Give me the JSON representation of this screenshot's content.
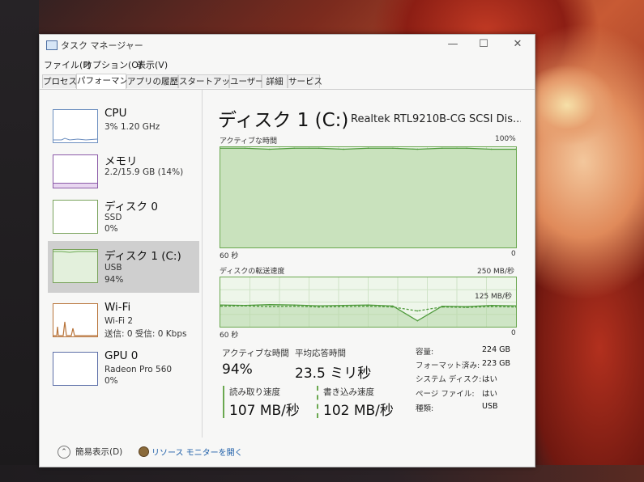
{
  "window": {
    "title": "タスク マネージャー",
    "controls": {
      "minimize": "—",
      "maximize": "☐",
      "close": "✕"
    }
  },
  "menu": [
    "ファイル(F)",
    "オプション(O)",
    "表示(V)"
  ],
  "tabs": [
    {
      "label": "プロセス",
      "active": false
    },
    {
      "label": "パフォーマンス",
      "active": true
    },
    {
      "label": "アプリの履歴",
      "active": false
    },
    {
      "label": "スタートアップ",
      "active": false
    },
    {
      "label": "ユーザー",
      "active": false
    },
    {
      "label": "詳細",
      "active": false
    },
    {
      "label": "サービス",
      "active": false
    }
  ],
  "sidebar": {
    "items": [
      {
        "name": "CPU",
        "sub1": "3%  1.20 GHz",
        "sub2": "",
        "color": "#6d8fc0",
        "selected": false
      },
      {
        "name": "メモリ",
        "sub1": "2.2/15.9 GB (14%)",
        "sub2": "",
        "color": "#8b5aa8",
        "selected": false
      },
      {
        "name": "ディスク 0",
        "sub1": "SSD",
        "sub2": "0%",
        "color": "#7aa35c",
        "selected": false
      },
      {
        "name": "ディスク 1 (C:)",
        "sub1": "USB",
        "sub2": "94%",
        "color": "#7aa35c",
        "selected": true
      },
      {
        "name": "Wi-Fi",
        "sub1": "Wi-Fi 2",
        "sub2": "送信: 0  受信: 0 Kbps",
        "color": "#b8743a",
        "selected": false
      },
      {
        "name": "GPU 0",
        "sub1": "Radeon Pro 560",
        "sub2": "0%",
        "color": "#5c6fa8",
        "selected": false
      }
    ]
  },
  "main": {
    "title": "ディスク 1 (C:)",
    "model": "Realtek RTL9210B-CG SCSI Dis...",
    "graph1": {
      "label": "アクティブな時間",
      "max": "100%",
      "time": "60 秒",
      "min": "0"
    },
    "graph2": {
      "label": "ディスクの転送速度",
      "max": "250 MB/秒",
      "mid": "125 MB/秒",
      "time": "60 秒",
      "min": "0"
    },
    "stats": {
      "active_label": "アクティブな時間",
      "active_value": "94%",
      "resp_label": "平均応答時間",
      "resp_value": "23.5 ミリ秒",
      "read_label": "読み取り速度",
      "read_value": "107 MB/秒",
      "write_label": "書き込み速度",
      "write_value": "102 MB/秒"
    },
    "properties": [
      {
        "key": "容量:",
        "value": "224 GB"
      },
      {
        "key": "フォーマット済み:",
        "value": "223 GB"
      },
      {
        "key": "システム ディスク:",
        "value": "はい"
      },
      {
        "key": "ページ ファイル:",
        "value": "はい"
      },
      {
        "key": "種類:",
        "value": "USB"
      }
    ]
  },
  "chart_data": [
    {
      "type": "area",
      "title": "アクティブな時間",
      "x": [
        60,
        55,
        50,
        45,
        40,
        35,
        30,
        25,
        20,
        15,
        10,
        5,
        0
      ],
      "series": [
        {
          "values": [
            99,
            99,
            98,
            99,
            99,
            98,
            99,
            99,
            98,
            99,
            99,
            98,
            98
          ]
        }
      ],
      "ylim": [
        0,
        100
      ]
    },
    {
      "type": "line",
      "title": "ディスクの転送速度",
      "x": [
        60,
        55,
        50,
        45,
        40,
        35,
        30,
        25,
        20,
        15,
        10,
        5,
        0
      ],
      "series": [
        {
          "values": [
            110,
            108,
            112,
            110,
            106,
            108,
            110,
            105,
            30,
            104,
            102,
            108,
            106
          ]
        },
        {
          "values": [
            104,
            106,
            102,
            104,
            100,
            102,
            104,
            100,
            80,
            100,
            98,
            102,
            100
          ]
        }
      ],
      "ylim": [
        0,
        250
      ]
    }
  ],
  "footer": {
    "fewer_details": "簡易表示(D)",
    "resource_monitor": "リソース モニターを開く"
  }
}
